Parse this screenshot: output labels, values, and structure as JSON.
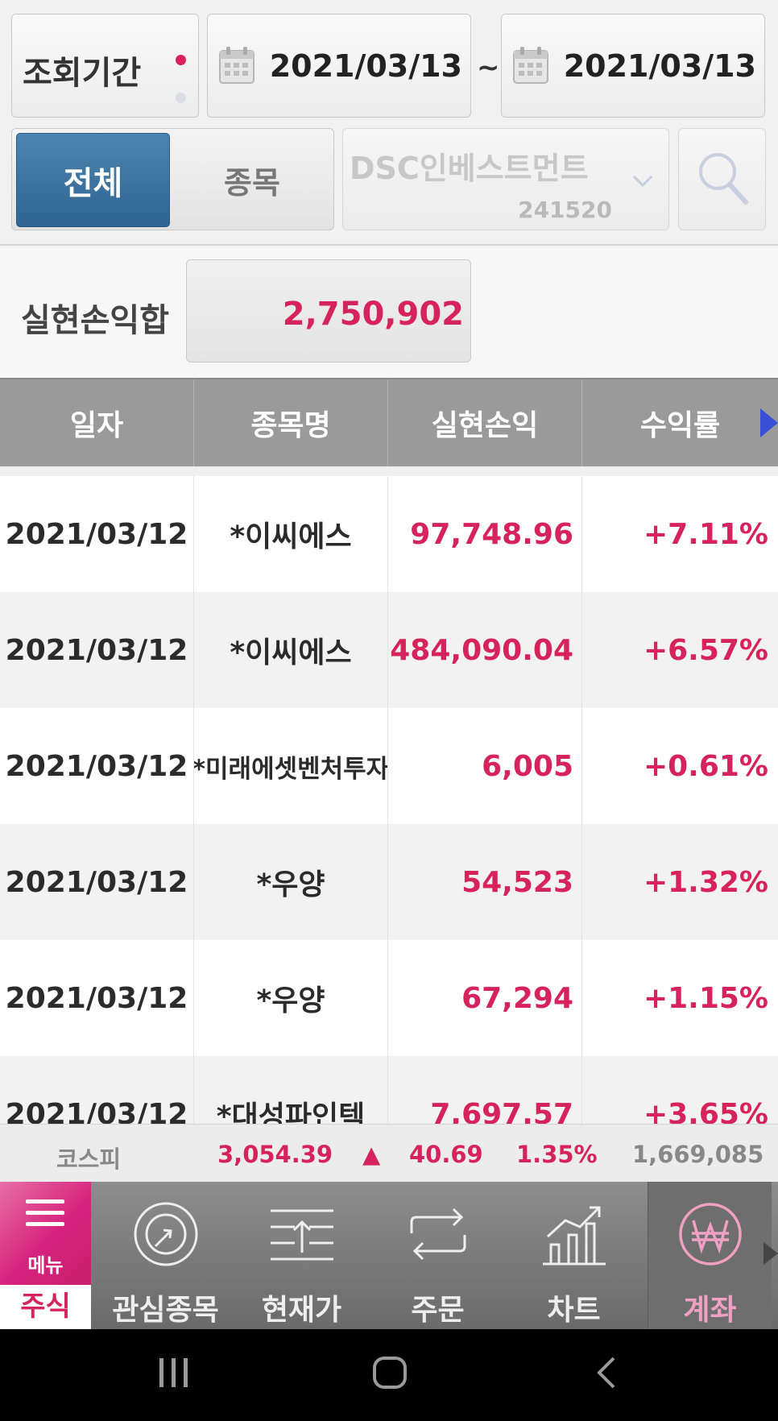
{
  "filter": {
    "period_label": "조회기간",
    "date_from": "2021/03/13",
    "date_to": "2021/03/13",
    "separator": "~",
    "segment_all": "전체",
    "segment_item": "종목",
    "stock_name": "DSC인베스트먼트",
    "stock_code": "241520"
  },
  "total": {
    "label": "실현손익합",
    "value": "2,750,902"
  },
  "table": {
    "headers": [
      "일자",
      "종목명",
      "실현손익",
      "수익률"
    ],
    "rows": [
      {
        "date": "2021/03/12",
        "name": "*이씨에스",
        "pl": "97,748.96",
        "rate": "+7.11%"
      },
      {
        "date": "2021/03/12",
        "name": "*이씨에스",
        "pl": "484,090.04",
        "rate": "+6.57%"
      },
      {
        "date": "2021/03/12",
        "name": "*미래에셋벤처투자",
        "pl": "6,005",
        "rate": "+0.61%"
      },
      {
        "date": "2021/03/12",
        "name": "*우양",
        "pl": "54,523",
        "rate": "+1.32%"
      },
      {
        "date": "2021/03/12",
        "name": "*우양",
        "pl": "67,294",
        "rate": "+1.15%"
      },
      {
        "date": "2021/03/12",
        "name": "*대성파인텍",
        "pl": "7,697.57",
        "rate": "+3.65%"
      }
    ]
  },
  "ticker": {
    "name": "코스피",
    "value": "3,054.39",
    "direction": "▲",
    "change": "40.69",
    "percent": "1.35%",
    "volume": "1,669,085"
  },
  "nav": {
    "menu_label": "메뉴",
    "stock_tab": "주식",
    "items": [
      {
        "label": "관심종목",
        "icon": "watchlist-icon"
      },
      {
        "label": "현재가",
        "icon": "current-price-icon"
      },
      {
        "label": "주문",
        "icon": "order-icon"
      },
      {
        "label": "차트",
        "icon": "chart-icon"
      },
      {
        "label": "계좌",
        "icon": "account-won-icon"
      }
    ]
  },
  "colors": {
    "accent": "#d6235e",
    "segment_active": "#3a6f9c",
    "header_gray": "#9a9a9a"
  }
}
